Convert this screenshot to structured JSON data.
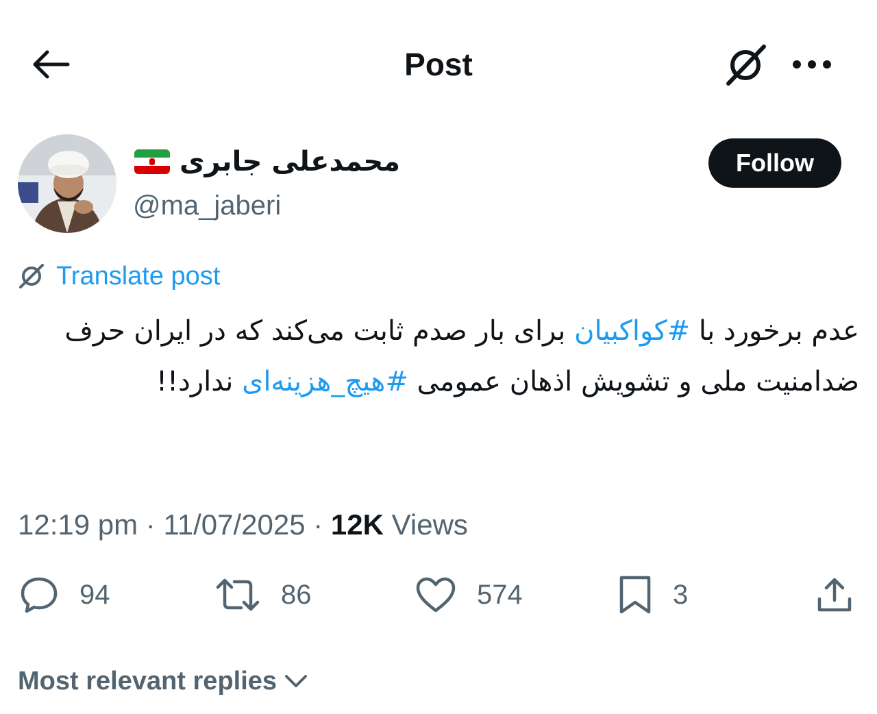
{
  "header": {
    "title": "Post"
  },
  "author": {
    "name": "محمدعلی جابری",
    "handle": "@ma_jaberi",
    "flag_emoji": "🇮🇷",
    "follow_label": "Follow"
  },
  "translate": {
    "label": "Translate post"
  },
  "tweet": {
    "line1_a": "عدم برخورد با ",
    "hashtag1": "#کواکبیان",
    "line1_b": " برای بار صدم ثابت می‌کند که در ایران حرف ضدامنیت ملی و تشویش اذهان عمومی ",
    "hashtag2": "#هیچ_هزینه‌ای",
    "line1_c": " ندارد!!"
  },
  "meta": {
    "time": "12:19 pm",
    "separator": "·",
    "date": "11/07/2025",
    "views_count": "12K",
    "views_label": "Views"
  },
  "actions": {
    "replies": "94",
    "reposts": "86",
    "likes": "574",
    "bookmarks": "3"
  },
  "replies_sort": {
    "label": "Most relevant replies"
  },
  "colors": {
    "text": "#0f1419",
    "secondary": "#536471",
    "link": "#1d9bf0",
    "button_bg": "#0f1419"
  },
  "icons": [
    "back-arrow-icon",
    "grok-icon",
    "more-icon",
    "translate-icon",
    "reply-icon",
    "repost-icon",
    "like-icon",
    "bookmark-icon",
    "share-icon",
    "chevron-down-icon"
  ]
}
